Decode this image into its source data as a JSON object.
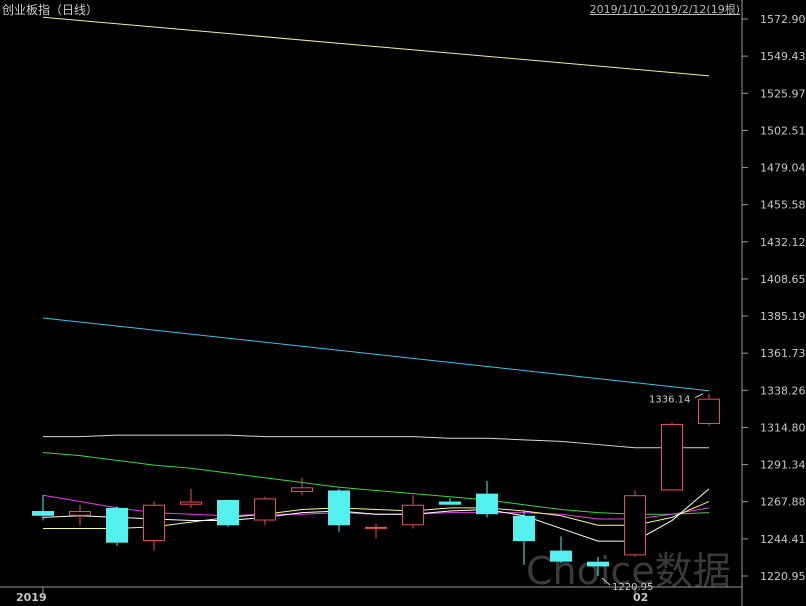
{
  "header": {
    "title": "创业板指（日线）",
    "date_range": "2019/1/10-2019/2/12(19根)"
  },
  "watermark": "Choice数据",
  "colors": {
    "background": "#000000",
    "up": "#e85050",
    "down": "#54f0f0",
    "axis": "#9a9a9a",
    "ma_lines": [
      "#f0f0a0",
      "#3cc4e8",
      "#d8d8d8",
      "#38d838",
      "#e040e8",
      "#f8f880",
      "#ffffff"
    ]
  },
  "chart_data": {
    "type": "candlestick",
    "ylim": [
      1209.0,
      1584.0
    ],
    "y_ticks": [
      "1572.90",
      "1549.43",
      "1525.97",
      "1502.51",
      "1479.04",
      "1455.58",
      "1432.12",
      "1408.65",
      "1385.19",
      "1361.73",
      "1338.26",
      "1314.80",
      "1291.34",
      "1267.88",
      "1244.41",
      "1220.95"
    ],
    "x_labels": [
      {
        "label": "2019",
        "index": 0
      },
      {
        "label": "02",
        "index": 16
      }
    ],
    "candles": [
      {
        "open": 1262,
        "high": 1272,
        "low": 1256,
        "close": 1259
      },
      {
        "open": 1259,
        "high": 1266,
        "low": 1253,
        "close": 1262
      },
      {
        "open": 1264,
        "high": 1265,
        "low": 1240,
        "close": 1242
      },
      {
        "open": 1243,
        "high": 1268,
        "low": 1237,
        "close": 1266
      },
      {
        "open": 1266,
        "high": 1276,
        "low": 1264,
        "close": 1268
      },
      {
        "open": 1269,
        "high": 1269,
        "low": 1252,
        "close": 1253
      },
      {
        "open": 1256,
        "high": 1271,
        "low": 1253,
        "close": 1270
      },
      {
        "open": 1274,
        "high": 1283,
        "low": 1272,
        "close": 1277
      },
      {
        "open": 1275,
        "high": 1276,
        "low": 1249,
        "close": 1253
      },
      {
        "open": 1251,
        "high": 1254,
        "low": 1245,
        "close": 1252
      },
      {
        "open": 1253,
        "high": 1272,
        "low": 1251,
        "close": 1266
      },
      {
        "open": 1268,
        "high": 1270,
        "low": 1266,
        "close": 1266
      },
      {
        "open": 1273,
        "high": 1281,
        "low": 1258,
        "close": 1260
      },
      {
        "open": 1259,
        "high": 1262,
        "low": 1228,
        "close": 1243
      },
      {
        "open": 1237,
        "high": 1246,
        "low": 1229,
        "close": 1230
      },
      {
        "open": 1230,
        "high": 1233,
        "low": 1221,
        "close": 1227
      },
      {
        "open": 1234,
        "high": 1275,
        "low": 1233,
        "close": 1272
      },
      {
        "open": 1275,
        "high": 1318,
        "low": 1275,
        "close": 1317
      },
      {
        "open": 1317,
        "high": 1336,
        "low": 1316,
        "close": 1333
      }
    ],
    "moving_averages": [
      {
        "color": "#f0f0a0",
        "start": 1574,
        "end": 1537
      },
      {
        "color": "#3cc4e8",
        "start": 1384,
        "end": 1338
      },
      {
        "color": "#d8d8d8",
        "values": [
          1309,
          1309,
          1310,
          1310,
          1310,
          1310,
          1309,
          1309,
          1309,
          1309,
          1309,
          1308,
          1308,
          1307,
          1306,
          1304,
          1302,
          1302,
          1302
        ]
      },
      {
        "color": "#38d838",
        "values": [
          1299,
          1297,
          1294,
          1291,
          1289,
          1286,
          1283,
          1280,
          1277,
          1275,
          1273,
          1271,
          1269,
          1266,
          1263,
          1261,
          1260,
          1260,
          1261
        ]
      },
      {
        "color": "#e040e8",
        "values": [
          1272,
          1268,
          1264,
          1261,
          1260,
          1259,
          1260,
          1260,
          1261,
          1260,
          1260,
          1261,
          1261,
          1261,
          1260,
          1257,
          1257,
          1260,
          1264
        ]
      },
      {
        "color": "#f8f880",
        "values": [
          1251,
          1251,
          1251,
          1252,
          1255,
          1258,
          1260,
          1263,
          1264,
          1263,
          1262,
          1264,
          1264,
          1262,
          1259,
          1253,
          1253,
          1258,
          1268
        ]
      },
      {
        "color": "#ffffff",
        "values": [
          1258,
          1259,
          1258,
          1257,
          1256,
          1256,
          1258,
          1261,
          1262,
          1260,
          1260,
          1262,
          1263,
          1259,
          1251,
          1243,
          1243,
          1256,
          1276
        ]
      }
    ],
    "annotations": [
      {
        "text": "1336.14",
        "index": 18,
        "value": 1336.14,
        "side": "left"
      },
      {
        "text": "1220.95",
        "index": 15,
        "value": 1220.95,
        "side": "right"
      }
    ]
  }
}
